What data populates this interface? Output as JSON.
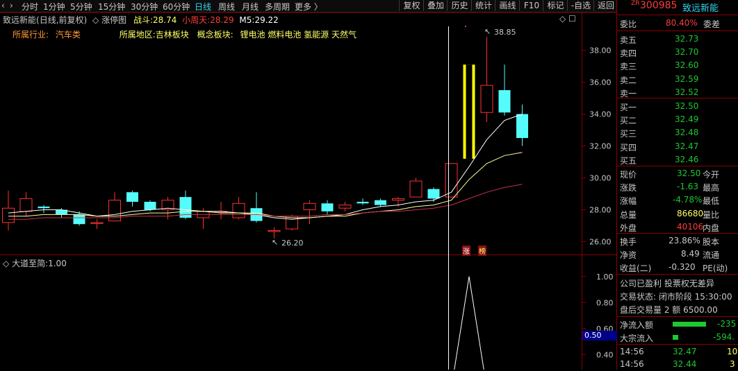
{
  "toolbar": {
    "timeframes": [
      "分时",
      "1分钟",
      "5分钟",
      "15分钟",
      "30分钟",
      "60分钟",
      "日线",
      "周线",
      "月线",
      "多周期",
      "更多 〉"
    ],
    "active_timeframe": "日线",
    "right_buttons": [
      "复权",
      "叠加",
      "历史",
      "统计",
      "画线",
      "F10",
      "标记",
      "-自选",
      "返回"
    ]
  },
  "chart_info": {
    "title": "致远新能",
    "subtitle": "(日线,前复权)",
    "zt_label": "涨停图",
    "zhandou_label": "战斗:",
    "zhandou_value": "28.74",
    "xiaozhou_label": "小周天:",
    "xiaozhou_value": "28.29",
    "m5_label": "M5:",
    "m5_value": "29.22"
  },
  "industry": {
    "industry_label": "所属行业:",
    "industry_value": "汽车类",
    "region_label": "所属地区:",
    "region_value": "吉林板块",
    "concept_label": "概念板块:",
    "concepts": [
      "锂电池",
      "燃料电池",
      "氢能源",
      "天然气"
    ]
  },
  "annotations": {
    "high": "38.85",
    "low": "26.20",
    "tag_zhang": "涨",
    "tag_bang": "榜",
    "window_icons": "◇ ☐"
  },
  "price_axis": [
    "38.00",
    "36.00",
    "34.00",
    "32.00",
    "30.00",
    "28.00",
    "26.00"
  ],
  "indicator": {
    "label": "大道至简:1.00",
    "axis": [
      "1.00",
      "0.80",
      "0.60",
      "0.40"
    ],
    "marker": "0.50"
  },
  "colors": {
    "up": "#ff3232",
    "down": "#54fcfc",
    "limit_up": "#ffff00",
    "ma_white": "#ffffff",
    "ma_yellow": "#ffff99",
    "ma_red": "#c83250",
    "accent_red": "#ff3b3b",
    "accent_green": "#1ec832"
  },
  "chart_data": {
    "type": "candlestick",
    "low_price": 26.2,
    "high_price": 38.85,
    "ylim": [
      25.5,
      39.5
    ],
    "candles": [
      {
        "o": 27.2,
        "c": 28.1,
        "h": 29.2,
        "l": 26.7
      },
      {
        "o": 27.9,
        "c": 28.7,
        "h": 29.1,
        "l": 27.6
      },
      {
        "o": 28.2,
        "c": 28.1,
        "h": 28.3,
        "l": 27.8
      },
      {
        "o": 28.0,
        "c": 27.7,
        "h": 28.1,
        "l": 27.5
      },
      {
        "o": 27.7,
        "c": 27.1,
        "h": 27.9,
        "l": 27.0
      },
      {
        "o": 27.2,
        "c": 27.2,
        "h": 27.4,
        "l": 26.8
      },
      {
        "o": 27.3,
        "c": 28.6,
        "h": 29.1,
        "l": 27.3
      },
      {
        "o": 29.1,
        "c": 28.5,
        "h": 29.2,
        "l": 28.2
      },
      {
        "o": 28.5,
        "c": 28.0,
        "h": 28.6,
        "l": 27.9
      },
      {
        "o": 28.0,
        "c": 28.6,
        "h": 28.8,
        "l": 27.4
      },
      {
        "o": 28.8,
        "c": 27.5,
        "h": 29.2,
        "l": 27.4
      },
      {
        "o": 27.5,
        "c": 27.9,
        "h": 28.1,
        "l": 26.8
      },
      {
        "o": 27.9,
        "c": 27.9,
        "h": 28.5,
        "l": 27.4
      },
      {
        "o": 27.5,
        "c": 28.4,
        "h": 28.8,
        "l": 27.4
      },
      {
        "o": 28.1,
        "c": 27.3,
        "h": 29.1,
        "l": 27.2
      },
      {
        "o": 26.7,
        "c": 26.7,
        "h": 26.9,
        "l": 26.2
      },
      {
        "o": 26.8,
        "c": 27.6,
        "h": 27.7,
        "l": 26.7
      },
      {
        "o": 28.0,
        "c": 28.4,
        "h": 28.6,
        "l": 27.1
      },
      {
        "o": 28.4,
        "c": 27.9,
        "h": 28.6,
        "l": 27.7
      },
      {
        "o": 28.1,
        "c": 28.3,
        "h": 28.5,
        "l": 27.9
      },
      {
        "o": 28.5,
        "c": 28.4,
        "h": 28.7,
        "l": 28.3
      },
      {
        "o": 28.6,
        "c": 28.3,
        "h": 28.7,
        "l": 28.2
      },
      {
        "o": 28.6,
        "c": 28.7,
        "h": 28.8,
        "l": 28.2
      },
      {
        "o": 28.8,
        "c": 29.8,
        "h": 30.0,
        "l": 28.8
      },
      {
        "o": 29.3,
        "c": 28.7,
        "h": 29.4,
        "l": 28.5
      },
      {
        "o": 28.8,
        "c": 30.9,
        "h": 30.9,
        "l": 28.8
      },
      {
        "o": 31.2,
        "c": 37.1,
        "h": 37.1,
        "l": 31.2,
        "limit": true
      },
      {
        "o": 34.1,
        "c": 35.8,
        "h": 38.85,
        "l": 33.5
      },
      {
        "o": 35.5,
        "c": 34.1,
        "h": 37.1,
        "l": 33.9
      },
      {
        "o": 34.0,
        "c": 32.5,
        "h": 34.6,
        "l": 32.0
      }
    ],
    "ma_white": [
      27.8,
      27.9,
      28.0,
      28.0,
      27.8,
      27.6,
      27.7,
      27.9,
      28.0,
      28.1,
      28.0,
      27.9,
      27.9,
      27.8,
      27.7,
      27.5,
      27.4,
      27.5,
      27.6,
      27.7,
      28.0,
      28.2,
      28.3,
      28.5,
      28.6,
      29.1,
      30.7,
      32.4,
      33.6,
      34.0
    ],
    "ma_yellow": [
      27.6,
      27.6,
      27.7,
      27.7,
      27.7,
      27.6,
      27.6,
      27.7,
      27.8,
      27.8,
      27.9,
      27.9,
      27.8,
      27.8,
      27.8,
      27.6,
      27.5,
      27.5,
      27.6,
      27.6,
      27.8,
      27.9,
      28.0,
      28.2,
      28.3,
      28.6,
      29.9,
      30.9,
      31.4,
      31.6
    ],
    "ma_red": [
      27.4,
      27.4,
      27.5,
      27.5,
      27.5,
      27.5,
      27.5,
      27.6,
      27.6,
      27.6,
      27.7,
      27.7,
      27.7,
      27.7,
      27.7,
      27.6,
      27.6,
      27.6,
      27.7,
      27.7,
      27.8,
      27.9,
      27.9,
      28.0,
      28.1,
      28.3,
      28.7,
      29.1,
      29.4,
      29.6
    ],
    "indicator_ylim": [
      0.3,
      1.1
    ],
    "indicator_values": [
      0,
      0,
      0,
      0,
      0,
      0,
      0,
      0,
      0,
      0,
      0,
      0,
      0,
      0,
      0,
      0,
      0,
      0,
      0,
      0,
      0,
      0,
      0,
      0,
      0.2,
      0,
      1.0,
      0,
      0,
      0
    ]
  },
  "quote": {
    "code_prefix": "ZR",
    "code": "300985",
    "name": "致远新能",
    "weibi_label": "委比",
    "weibi_value": "80.40%",
    "weicha_label": "委差",
    "asks": [
      {
        "label": "卖五",
        "price": "32.73"
      },
      {
        "label": "卖四",
        "price": "32.70"
      },
      {
        "label": "卖三",
        "price": "32.60"
      },
      {
        "label": "卖二",
        "price": "32.59"
      },
      {
        "label": "卖一",
        "price": "32.52"
      }
    ],
    "bids": [
      {
        "label": "买一",
        "price": "32.50"
      },
      {
        "label": "买二",
        "price": "32.49"
      },
      {
        "label": "买三",
        "price": "32.48"
      },
      {
        "label": "买四",
        "price": "32.47"
      },
      {
        "label": "买五",
        "price": "32.46"
      }
    ],
    "stats": [
      {
        "label": "现价",
        "value": "32.50",
        "tail": "今开"
      },
      {
        "label": "涨跌",
        "value": "-1.63",
        "tail": "最高"
      },
      {
        "label": "涨幅",
        "value": "-4.78%",
        "tail": "最低"
      },
      {
        "label": "总量",
        "value": "86680",
        "tail": "量比"
      },
      {
        "label": "外盘",
        "value": "40106",
        "tail": "内盘"
      }
    ],
    "stats2": [
      {
        "label": "换手",
        "value": "23.86%",
        "tail": "股本"
      },
      {
        "label": "净资",
        "value": "8.49",
        "tail": "流通"
      },
      {
        "label": "收益(二)",
        "value": "-0.320",
        "tail": "PE(动)"
      }
    ],
    "notes": [
      "公司已盈利 投票权无差异",
      "交易状态: 闭市阶段 15:30:00",
      "盘后交易量 2 额 6500.00"
    ],
    "flows": [
      {
        "label": "净流入额",
        "value": "-235"
      },
      {
        "label": "大宗流入",
        "value": "-594."
      }
    ],
    "ticks": [
      {
        "time": "14:56",
        "price": "32.47",
        "vol": "10"
      },
      {
        "time": "14:56",
        "price": "32.44",
        "vol": "3"
      }
    ]
  }
}
